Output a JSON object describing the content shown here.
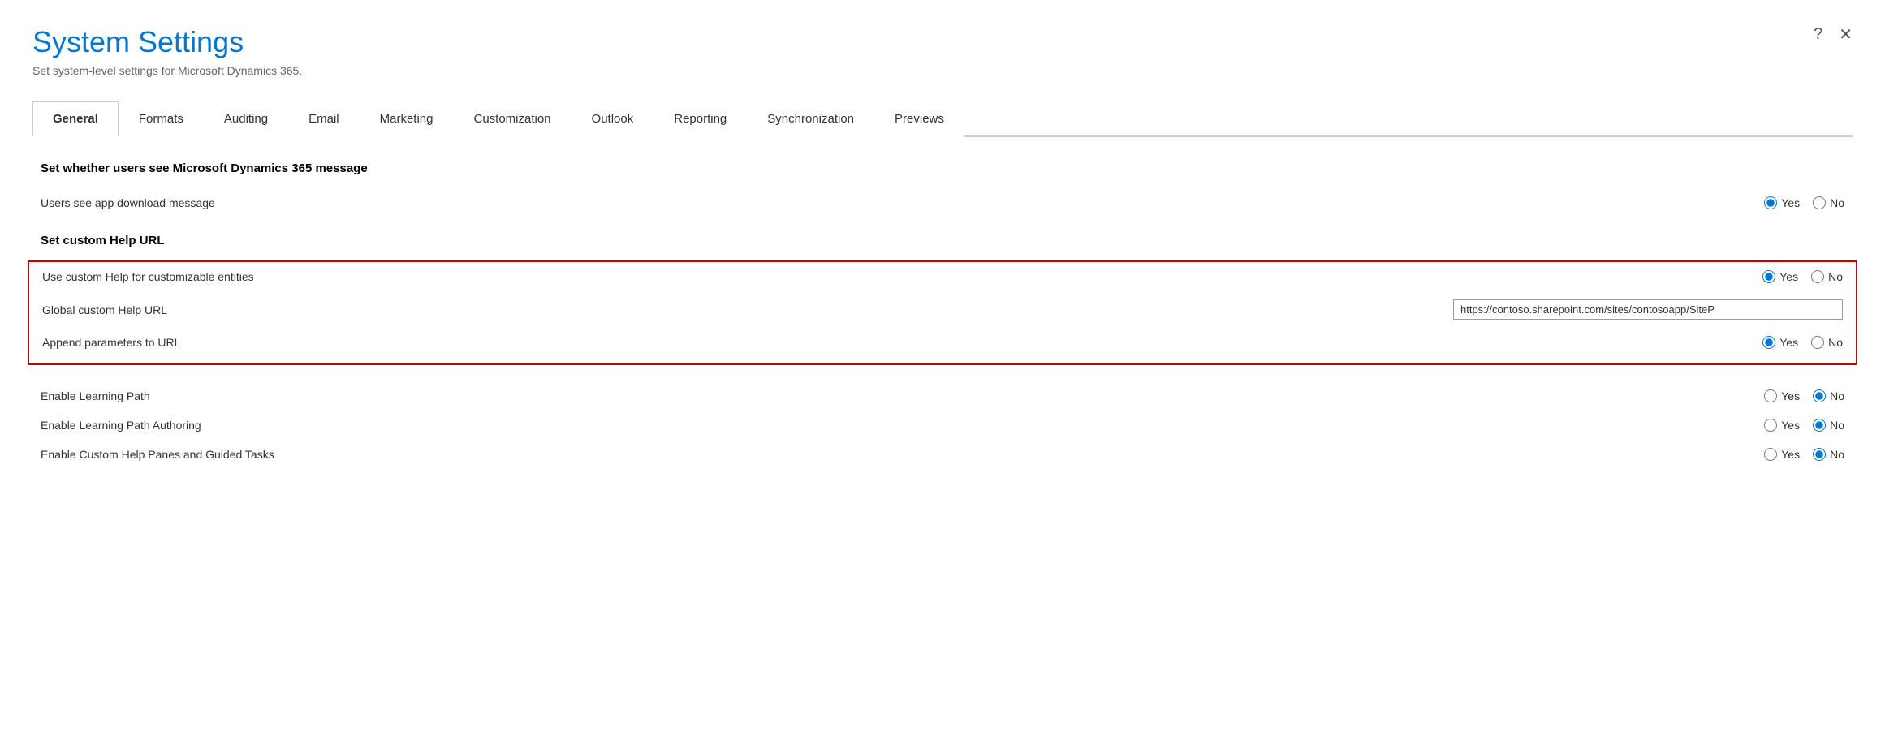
{
  "dialog": {
    "title": "System Settings",
    "subtitle": "Set system-level settings for Microsoft Dynamics 365.",
    "help_icon": "?",
    "close_icon": "✕"
  },
  "tabs": [
    {
      "id": "general",
      "label": "General",
      "active": true
    },
    {
      "id": "formats",
      "label": "Formats",
      "active": false
    },
    {
      "id": "auditing",
      "label": "Auditing",
      "active": false
    },
    {
      "id": "email",
      "label": "Email",
      "active": false
    },
    {
      "id": "marketing",
      "label": "Marketing",
      "active": false
    },
    {
      "id": "customization",
      "label": "Customization",
      "active": false
    },
    {
      "id": "outlook",
      "label": "Outlook",
      "active": false
    },
    {
      "id": "reporting",
      "label": "Reporting",
      "active": false
    },
    {
      "id": "synchronization",
      "label": "Synchronization",
      "active": false
    },
    {
      "id": "previews",
      "label": "Previews",
      "active": false
    }
  ],
  "sections": {
    "message_section": {
      "title": "Set whether users see Microsoft Dynamics 365 message",
      "settings": [
        {
          "id": "app_download_message",
          "label": "Users see app download message",
          "type": "radio",
          "value": "yes",
          "options": [
            "Yes",
            "No"
          ]
        }
      ]
    },
    "help_url_section": {
      "title": "Set custom Help URL",
      "outlined": true,
      "settings": [
        {
          "id": "custom_help_entities",
          "label": "Use custom Help for customizable entities",
          "type": "radio",
          "value": "yes",
          "options": [
            "Yes",
            "No"
          ]
        },
        {
          "id": "global_custom_help_url",
          "label": "Global custom Help URL",
          "type": "text",
          "value": "https://contoso.sharepoint.com/sites/contosoapp/SiteP"
        },
        {
          "id": "append_parameters",
          "label": "Append parameters to URL",
          "type": "radio",
          "value": "yes",
          "options": [
            "Yes",
            "No"
          ]
        }
      ]
    },
    "learning_section": {
      "settings": [
        {
          "id": "enable_learning_path",
          "label": "Enable Learning Path",
          "type": "radio",
          "value": "no",
          "options": [
            "Yes",
            "No"
          ]
        },
        {
          "id": "enable_learning_path_authoring",
          "label": "Enable Learning Path Authoring",
          "type": "radio",
          "value": "no",
          "options": [
            "Yes",
            "No"
          ]
        },
        {
          "id": "enable_custom_help_panes",
          "label": "Enable Custom Help Panes and Guided Tasks",
          "type": "radio",
          "value": "no",
          "options": [
            "Yes",
            "No"
          ]
        }
      ]
    }
  }
}
